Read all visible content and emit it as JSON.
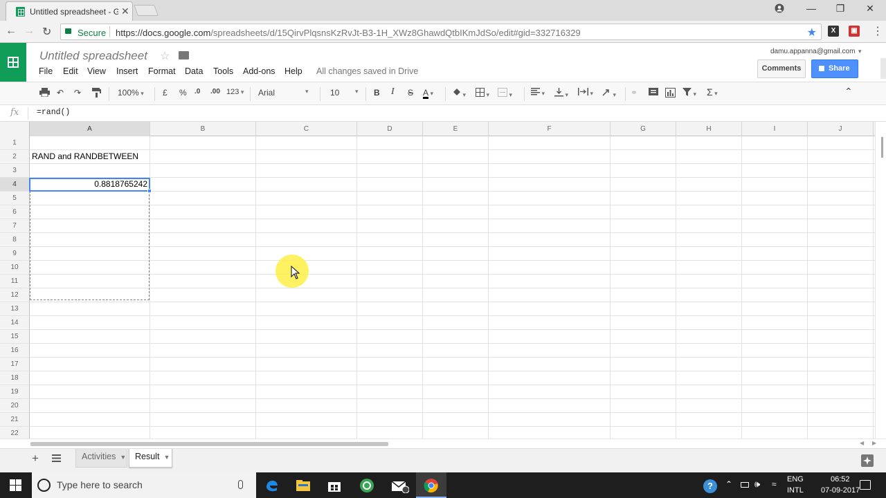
{
  "browser": {
    "tab_title": "Untitled spreadsheet - Goo",
    "tab_close": "✕",
    "window_buttons": [
      "—",
      "❐",
      "✕"
    ],
    "secure_label": "Secure",
    "url_host": "https://docs.google.com",
    "url_path": "/spreadsheets/d/15QirvPlqsnsKzRvJt-B3-1H_XWz8GhawdQtbIKmJdSo/edit#gid=332716329"
  },
  "doc": {
    "title": "Untitled spreadsheet",
    "menus": [
      "File",
      "Edit",
      "View",
      "Insert",
      "Format",
      "Data",
      "Tools",
      "Add-ons",
      "Help"
    ],
    "save_status": "All changes saved in Drive",
    "account": "damu.appanna@gmail.com",
    "comments_label": "Comments",
    "share_label": "Share"
  },
  "toolbar": {
    "zoom": "100%",
    "currency": "£",
    "percent": "%",
    "dec_decrease": ".0",
    "dec_increase": ".00",
    "more_formats": "123",
    "font": "Arial",
    "font_size": "10",
    "bold": "B",
    "italic": "I",
    "strike": "S",
    "text_color": "A",
    "functions": "Σ"
  },
  "formula_bar": {
    "fx": "fx",
    "value": "=rand()"
  },
  "grid": {
    "columns": [
      "A",
      "B",
      "C",
      "D",
      "E",
      "F",
      "G",
      "H",
      "I",
      "J"
    ],
    "rows": [
      "1",
      "2",
      "3",
      "4",
      "5",
      "6",
      "7",
      "8",
      "9",
      "10",
      "11",
      "12",
      "13",
      "14",
      "15",
      "16",
      "17",
      "18",
      "19",
      "20",
      "21",
      "22"
    ],
    "cell_A2": "RAND and RANDBETWEEN",
    "cell_A4": "0.8818765242",
    "selected_cell": "A4"
  },
  "sheets": {
    "tabs": [
      "Activities",
      "Result"
    ],
    "active": "Result"
  },
  "taskbar": {
    "search_placeholder": "Type here to search",
    "lang_top": "ENG",
    "lang_bottom": "INTL",
    "time": "06:52",
    "date": "07-09-2017"
  },
  "colors": {
    "sheets_green": "#0f9d58",
    "share_blue": "#4d90fe",
    "selection_blue": "#4285f4",
    "secure_green": "#0b8043"
  }
}
